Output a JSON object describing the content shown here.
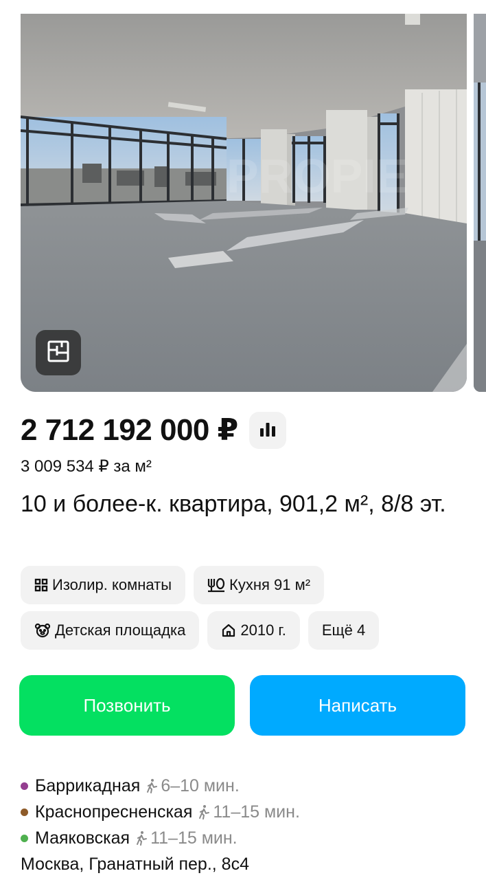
{
  "listing": {
    "price": "2 712 192 000 ₽",
    "price_per_m": "3 009 534 ₽ за м²",
    "title": "10 и более-к. квартира, 901,2 м², 8/8 эт.",
    "photo_watermark": "PROPIE"
  },
  "chips": [
    {
      "label": "Изолир. комнаты",
      "icon": "rooms-grid-icon"
    },
    {
      "label": "Кухня 91 м²",
      "icon": "kitchen-icon"
    },
    {
      "label": "Детская площадка",
      "icon": "playground-bear-icon"
    },
    {
      "label": "2010 г.",
      "icon": "house-icon"
    },
    {
      "label": "Ещё 4",
      "icon": ""
    }
  ],
  "actions": {
    "call_label": "Позвонить",
    "write_label": "Написать"
  },
  "metro": [
    {
      "name": "Баррикадная",
      "time": "6–10 мин.",
      "color": "#943e90"
    },
    {
      "name": "Краснопресненская",
      "time": "11–15 мин.",
      "color": "#8e5b29"
    },
    {
      "name": "Маяковская",
      "time": "11–15 мин.",
      "color": "#4fb04f"
    }
  ],
  "address": "Москва, Гранатный пер., 8с4",
  "colors": {
    "call_button": "#04e061",
    "write_button": "#00aaff",
    "chip_bg": "#f2f2f2"
  }
}
